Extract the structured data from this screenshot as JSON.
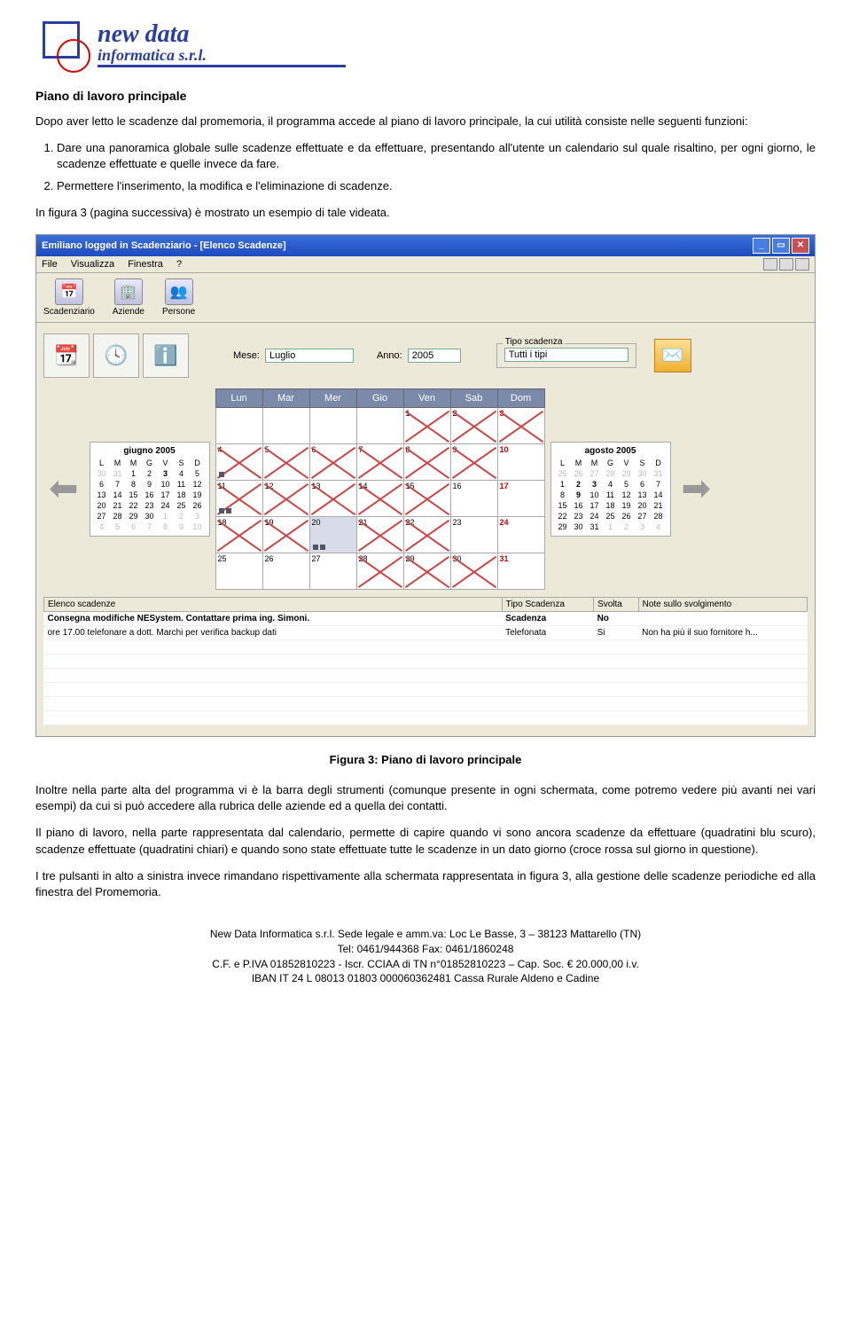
{
  "logo": {
    "brand1": "new data",
    "brand2": "informatica s.r.l."
  },
  "heading": "Piano di lavoro principale",
  "p1": "Dopo aver letto le scadenze dal promemoria, il programma accede al piano di lavoro principale, la cui utilità consiste nelle seguenti funzioni:",
  "li1": "Dare una panoramica globale sulle scadenze effettuate e da effettuare, presentando all'utente un calendario sul quale risaltino, per ogni giorno, le scadenze effettuate e quelle invece da fare.",
  "li2": "Permettere l'inserimento, la modifica e l'eliminazione di scadenze.",
  "p2": "In figura 3 (pagina successiva) è mostrato un esempio di tale videata.",
  "win": {
    "title": "Emiliano logged in Scadenziario - [Elenco Scadenze]",
    "menu": {
      "file": "File",
      "visualizza": "Visualizza",
      "finestra": "Finestra",
      "help": "?"
    },
    "tb": {
      "scad": "Scadenziario",
      "az": "Aziende",
      "per": "Persone"
    },
    "mese_lbl": "Mese:",
    "mese": "Luglio",
    "anno_lbl": "Anno:",
    "anno": "2005",
    "tipo_lbl": "Tipo scadenza",
    "tipo": "Tutti i tipi",
    "days": [
      "Lun",
      "Mar",
      "Mer",
      "Gio",
      "Ven",
      "Sab",
      "Dom"
    ],
    "mini1": {
      "title": "giugno 2005",
      "dh": [
        "L",
        "M",
        "M",
        "G",
        "V",
        "S",
        "D"
      ]
    },
    "mini2": {
      "title": "agosto 2005",
      "dh": [
        "L",
        "M",
        "M",
        "G",
        "V",
        "S",
        "D"
      ]
    },
    "cols": {
      "c1": "Elenco scadenze",
      "c2": "Tipo Scadenza",
      "c3": "Svolta",
      "c4": "Note sullo svolgimento"
    },
    "row1": {
      "a": "Consegna modifiche NESystem. Contattare prima ing. Simoni.",
      "b": "Scadenza",
      "c": "No",
      "d": ""
    },
    "row2": {
      "a": "ore 17.00 telefonare a dott. Marchi per verifica backup dati",
      "b": "Telefonata",
      "c": "Si",
      "d": "Non ha più il suo fornitore h..."
    }
  },
  "caption": "Figura 3: Piano di lavoro principale",
  "p3": "Inoltre nella parte alta del programma vi è la barra degli strumenti (comunque presente in ogni schermata, come potremo vedere più avanti nei vari esempi) da cui si può accedere alla rubrica delle aziende ed a quella dei contatti.",
  "p4": "Il piano di lavoro, nella parte rappresentata dal calendario, permette di capire quando vi sono ancora scadenze da effettuare (quadratini blu scuro), scadenze effettuate (quadratini chiari) e quando sono state effettuate tutte le scadenze in un dato giorno (croce rossa sul giorno in questione).",
  "p5": "I tre pulsanti in alto a sinistra invece rimandano rispettivamente alla schermata rappresentata in figura 3, alla gestione delle scadenze periodiche ed alla finestra del Promemoria.",
  "footer": {
    "l1": "New Data Informatica s.r.l.  Sede legale e amm.va: Loc Le Basse, 3 – 38123 Mattarello (TN)",
    "l2": "Tel: 0461/944368   Fax: 0461/1860248",
    "l3": "C.F.  e  P.IVA 01852810223 -  Iscr. CCIAA di TN n°01852810223 – Cap. Soc. € 20.000,00 i.v.",
    "l4": "IBAN IT 24 L 08013 01803 000060362481 Cassa Rurale Aldeno e Cadine"
  }
}
